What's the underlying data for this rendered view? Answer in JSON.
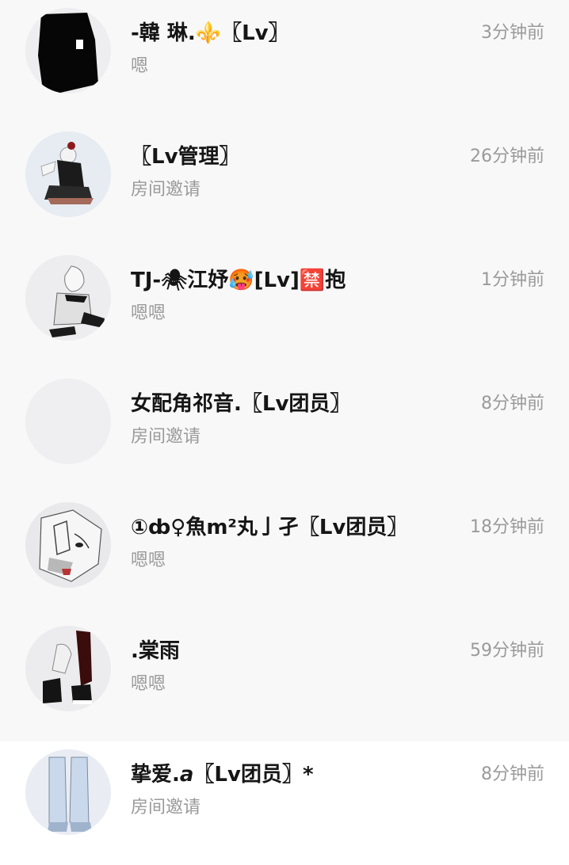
{
  "conversations": [
    {
      "name": "-韓 琳.⚜️〖Lv〗",
      "time": "3分钟前",
      "message": "嗯"
    },
    {
      "name": "〖Lv管理〗",
      "time": "26分钟前",
      "message": "房间邀请"
    },
    {
      "name": "TJ-🕷江妤🥵[Lv]🈲抱",
      "time": "1分钟前",
      "message": "嗯嗯"
    },
    {
      "name": "女配角祁音.〖Lv团员〗",
      "time": "8分钟前",
      "message": "房间邀请"
    },
    {
      "name": "①ȸ♀魚m²丸亅孑〖Lv团员〗",
      "time": "18分钟前",
      "message": "嗯嗯"
    },
    {
      "name": ".棠雨",
      "time": "59分钟前",
      "message": "嗯嗯"
    },
    {
      "name": "挚爱.𝙖〖Lv团员〗*",
      "time": "8分钟前",
      "message": "房间邀请"
    }
  ]
}
